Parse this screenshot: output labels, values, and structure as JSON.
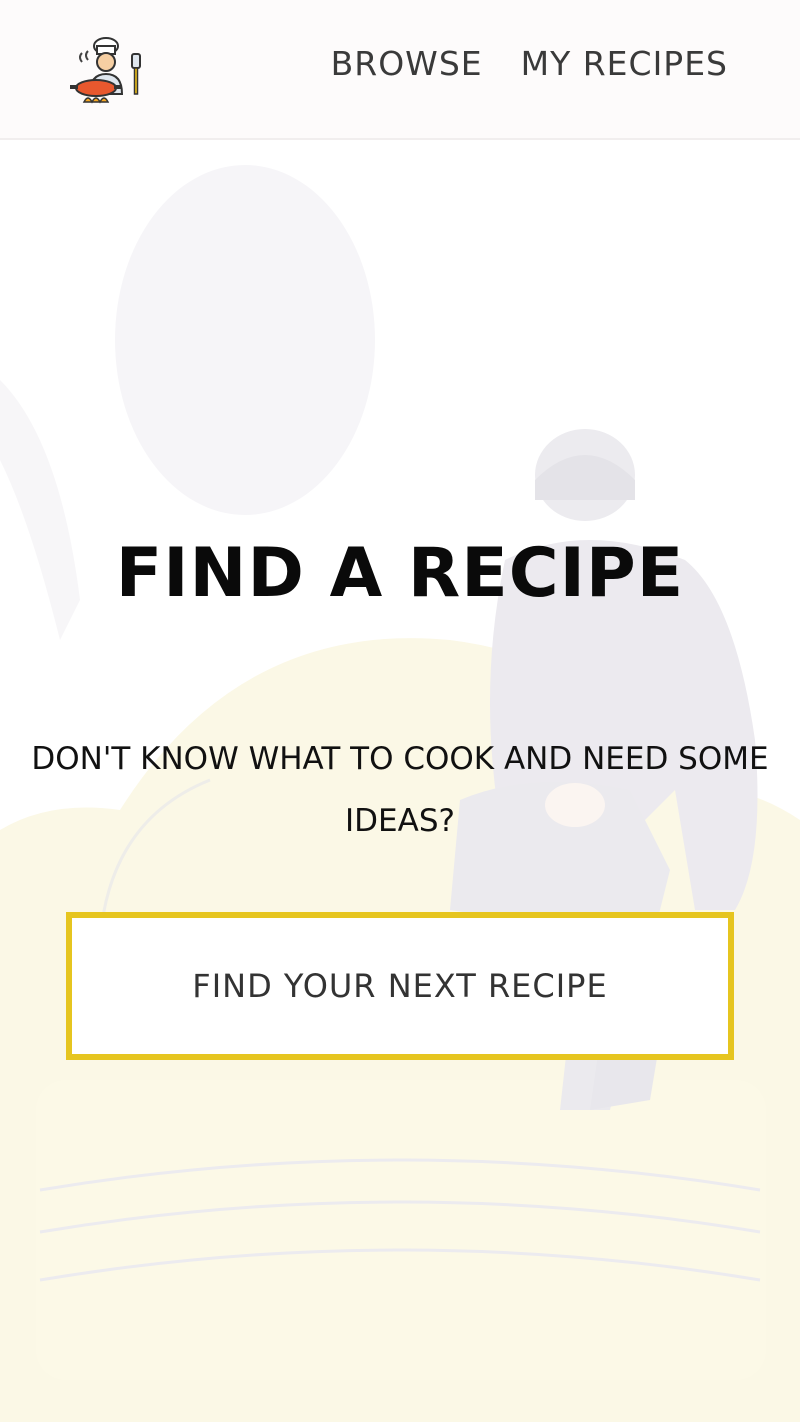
{
  "header": {
    "logo_icon": "chef-cooking-icon",
    "nav": [
      {
        "label": "BROWSE"
      },
      {
        "label": "MY RECIPES"
      }
    ]
  },
  "hero": {
    "title": "FIND A RECIPE",
    "subtitle": "DON'T KNOW WHAT TO COOK AND NEED SOME IDEAS?",
    "cta_label": "FIND YOUR NEXT RECIPE",
    "background_icon": "person-sitting-on-couch-illustration"
  },
  "colors": {
    "accent": "#e6c51f",
    "text_dark": "#0a0a0a",
    "nav_text": "#3a3a3a",
    "couch": "#fbf7e3",
    "figure": "#ecebee"
  }
}
